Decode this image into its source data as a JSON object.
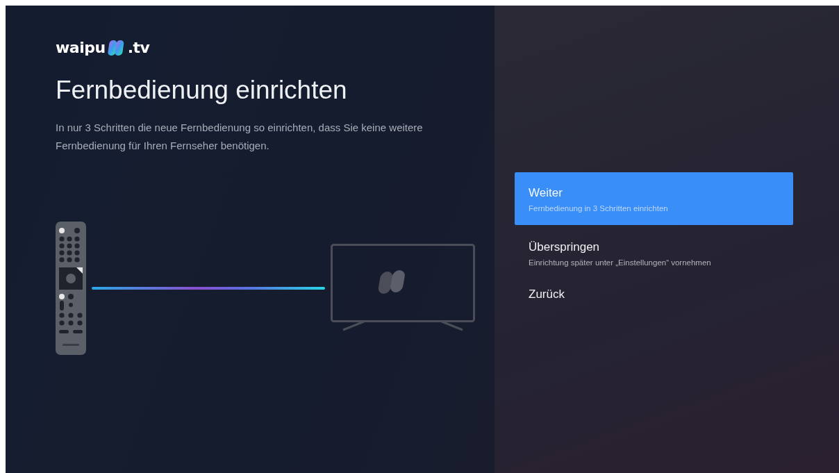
{
  "logo": {
    "name": "waipu",
    "suffix": ".tv"
  },
  "title": "Fernbedienung einrichten",
  "description": "In nur 3 Schritten die neue Fernbedienung so einrichten, dass Sie keine weitere Fernbedienung für Ihren Fernseher benötigen.",
  "options": [
    {
      "label": "Weiter",
      "subtitle": "Fernbedienung in 3 Schritten einrichten",
      "selected": true
    },
    {
      "label": "Überspringen",
      "subtitle": "Einrichtung später unter „Einstellungen“ vornehmen",
      "selected": false
    },
    {
      "label": "Zurück",
      "selected": false
    }
  ]
}
